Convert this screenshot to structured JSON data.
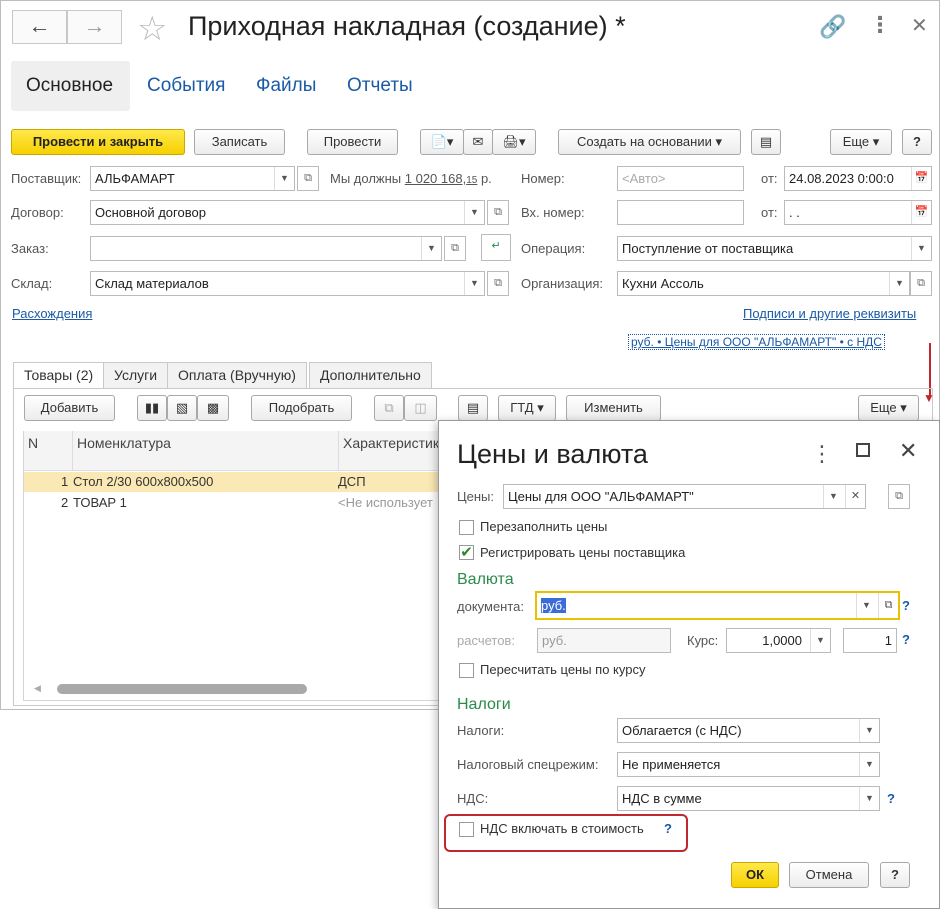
{
  "window": {
    "title": "Приходная накладная (создание) *",
    "back_icon": "arrow-left",
    "forward_icon": "arrow-right",
    "star_icon": "star-outline",
    "link_icon": "chain-link",
    "more_icon": "vertical-dots",
    "close_icon": "x"
  },
  "tabs": [
    "Основное",
    "События",
    "Файлы",
    "Отчеты"
  ],
  "toolbar": {
    "post_close": "Провести и закрыть",
    "save": "Записать",
    "post": "Провести",
    "create_based": "Создать на основании",
    "more": "Еще",
    "help": "?"
  },
  "form": {
    "supplier_label": "Поставщик:",
    "supplier_value": "АЛЬФАМАРТ",
    "owe_label": "Мы должны",
    "owe_amount": "1 020 168,",
    "owe_kopecks": "15",
    "owe_currency": "р.",
    "number_label": "Номер:",
    "number_placeholder": "<Авто>",
    "date_from_label": "от:",
    "date_value": "24.08.2023  0:00:0",
    "contract_label": "Договор:",
    "contract_value": "Основной договор",
    "in_number_label": "Вх. номер:",
    "in_date_label": "от:",
    "in_date_value": "  .  .",
    "order_label": "Заказ:",
    "order_value": "",
    "operation_label": "Операция:",
    "operation_value": "Поступление от поставщика",
    "warehouse_label": "Склад:",
    "warehouse_value": "Склад материалов",
    "org_label": "Организация:",
    "org_value": "Кухни Ассоль",
    "discrepancies_link": "Расхождения",
    "signatures_link": "Подписи и другие реквизиты",
    "prices_link": "руб. • Цены для ООО \"АЛЬФАМАРТ\" • с НДС"
  },
  "subtabs": [
    "Товары (2)",
    "Услуги",
    "Оплата (Вручную)",
    "Дополнительно"
  ],
  "goods_toolbar": {
    "add": "Добавить",
    "pick": "Подобрать",
    "gtd": "ГТД",
    "change": "Изменить",
    "more": "Еще"
  },
  "grid": {
    "columns": [
      "N",
      "Номенклатура",
      "Характеристик"
    ],
    "rows": [
      {
        "n": "1",
        "name": "Стол 2/30 600х800х500",
        "char": "ДСП"
      },
      {
        "n": "2",
        "name": "ТОВАР 1",
        "char": "<Не использует"
      }
    ]
  },
  "dialog": {
    "title": "Цены и валюта",
    "prices_label": "Цены:",
    "prices_value": "Цены для ООО \"АЛЬФАМАРТ\"",
    "refill_label": "Перезаполнить цены",
    "register_label": "Регистрировать цены поставщика",
    "currency_section": "Валюта",
    "doc_label": "документа:",
    "doc_value": "руб.",
    "settle_label": "расчетов:",
    "settle_value": "руб.",
    "rate_label": "Курс:",
    "rate_value": "1,0000",
    "multiplicity_value": "1",
    "recalc_label": "Пересчитать цены по курсу",
    "tax_section": "Налоги",
    "taxes_label": "Налоги:",
    "taxes_value": "Облагается (с НДС)",
    "regime_label": "Налоговый спецрежим:",
    "regime_value": "Не применяется",
    "vat_label": "НДС:",
    "vat_value": "НДС в сумме",
    "vat_include_label": "НДС включать в стоимость",
    "help_q": "?",
    "ok": "ОК",
    "cancel": "Отмена",
    "help": "?"
  },
  "colors": {
    "accent_yellow": "#f6d000",
    "link": "#1a5aa6",
    "section_green": "#2a8a4a",
    "highlight_red": "#c0282d",
    "row_selected": "#fbe9b5"
  }
}
